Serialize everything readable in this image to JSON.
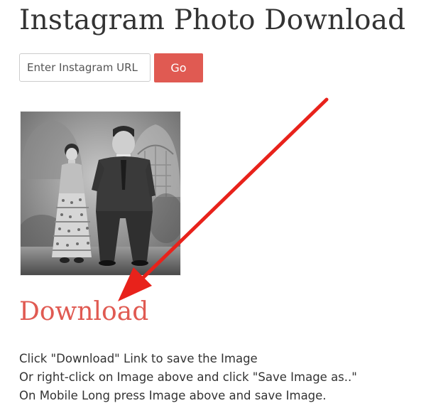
{
  "header": {
    "title": "Instagram Photo Download"
  },
  "search": {
    "placeholder": "Enter Instagram URL",
    "button_label": "Go"
  },
  "download": {
    "link_label": "Download"
  },
  "instructions": [
    "Click \"Download\" Link to save the Image",
    "Or right-click on Image above and click \"Save Image as..\"",
    "On Mobile Long press Image above and save Image."
  ],
  "colors": {
    "accent": "#e05a52",
    "arrow": "#e8221b",
    "text": "#333333"
  }
}
